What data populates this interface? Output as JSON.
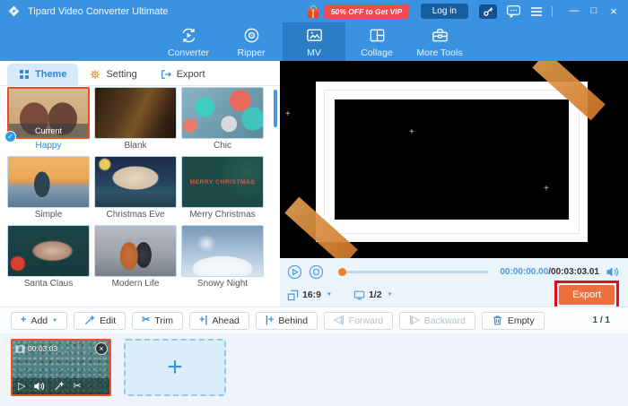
{
  "titlebar": {
    "title": "Tipard Video Converter Ultimate",
    "promo": "50% OFF to Get VIP",
    "login_label": "Log in"
  },
  "tabs": [
    {
      "id": "converter",
      "label": "Converter",
      "icon": "converter-icon",
      "active": false
    },
    {
      "id": "ripper",
      "label": "Ripper",
      "icon": "ripper-icon",
      "active": false
    },
    {
      "id": "mv",
      "label": "MV",
      "icon": "mv-icon",
      "active": true
    },
    {
      "id": "collage",
      "label": "Collage",
      "icon": "collage-icon",
      "active": false
    },
    {
      "id": "more-tools",
      "label": "More Tools",
      "icon": "more-tools-icon",
      "active": false
    }
  ],
  "panel": {
    "tabs": [
      {
        "id": "theme",
        "label": "Theme",
        "icon": "theme-grid-icon",
        "active": true
      },
      {
        "id": "setting",
        "label": "Setting",
        "icon": "gear-icon",
        "active": false
      },
      {
        "id": "export",
        "label": "Export",
        "icon": "export-icon",
        "active": false
      }
    ]
  },
  "themes": [
    {
      "name": "Happy",
      "selected": true,
      "badge": "Current",
      "bg": "radial-gradient(ellipse 30% 55% at 32% 62%, #7a4a3a 0%, #7a4a3a 60%, transparent 62%), radial-gradient(ellipse 30% 55% at 68% 62%, #6a4434 0%, #6a4434 60%, transparent 62%), linear-gradient(180deg,#d8b890,#c8a070)"
    },
    {
      "name": "Blank",
      "bg": "linear-gradient(115deg,#2a1c10 0%, #54381e 35%, #7a5428 55%, #3a2414 80%, #1e120a 100%)"
    },
    {
      "name": "Chic",
      "bg": "radial-gradient(circle 11px at 28% 38%, #3ecfc4 98%, transparent), radial-gradient(circle 12px at 72% 25%, #e86a5c 98%, transparent), radial-gradient(circle 9px at 58% 72%, #d8dade 98%, transparent), radial-gradient(circle 13px at 88% 62%, #42c4bc 98%, transparent), radial-gradient(circle 8px at 10% 75%, #e87a6c 98%, transparent), linear-gradient(135deg,#8ab4c4,#5a8a9c)"
    },
    {
      "name": "Simple",
      "bg": "radial-gradient(ellipse 16% 42% at 42% 55%, #2e4450 0%, #2e4450 60%, transparent 62%), linear-gradient(180deg,#f0b468 0%, #ecaa58 40%, #d89858 52%, #88a0b0 58%, #5a7a96 100%)"
    },
    {
      "name": "Christmas Eve",
      "bg": "radial-gradient(ellipse 55% 45% at 50% 42%, #e8d8c0 0%, #d0c0a8 50%, transparent 53%), radial-gradient(circle at 12% 15%, #e8c860 6%, transparent 8%), linear-gradient(180deg,#1c2c4a 0%, #24405c 45%, #2e5468 70%, #243c4a 100%)"
    },
    {
      "name": "Merry Christmas",
      "text": "MERRY CHRISTMAS",
      "bg": "radial-gradient(circle at 80% 30%, #2a5a55 0%, transparent 40%), #1d4a47"
    },
    {
      "name": "Santa Claus",
      "bg": "radial-gradient(ellipse 50% 40% at 55% 50%, #d8b8a0 0%, #b08878 45%, transparent 52%), radial-gradient(circle at 12% 75%, #d8402e 8%, transparent 10%), linear-gradient(180deg,#1e4546,#173a3c)"
    },
    {
      "name": "Modern Life",
      "bg": "radial-gradient(ellipse 18% 45% at 42% 60%, #c8703a 0%, #b86030 60%, transparent 63%), radial-gradient(ellipse 16% 42% at 60% 58%, #3a3a42 0%, #2a2a32 60%, transparent 63%), linear-gradient(180deg,#b8bcc4 0%, #9aa0a8 60%, #787e88 100%)"
    },
    {
      "name": "Snowy Night",
      "bg": "radial-gradient(ellipse 60% 40% at 50% 85%, #f8fafc 0%, #eef2f8 60%, transparent 63%), radial-gradient(ellipse 20% 30% at 30% 35%, #e8eef4 0%, transparent 60%), linear-gradient(180deg,#7a98b8 0%, #a8c0d8 50%, #d8e4f0 100%)"
    }
  ],
  "preview": {
    "time_current": "00:00:00.00",
    "time_total": "/00:03:03.01",
    "aspect_ratio": "16:9",
    "screen_page": "1/2",
    "export_label": "Export"
  },
  "toolbar": {
    "buttons": [
      {
        "name": "add-button",
        "label": "Add",
        "glyph": "+",
        "caret": true,
        "disabled": false
      },
      {
        "name": "edit-button",
        "label": "Edit",
        "icon": "wand-icon",
        "disabled": false
      },
      {
        "name": "trim-button",
        "label": "Trim",
        "glyph": "✂",
        "disabled": false
      },
      {
        "name": "ahead-button",
        "label": "Ahead",
        "glyph": "+|",
        "disabled": false
      },
      {
        "name": "behind-button",
        "label": "Behind",
        "glyph": "|+",
        "disabled": false
      },
      {
        "name": "forward-button",
        "label": "Forward",
        "glyph": "◁|",
        "disabled": true
      },
      {
        "name": "backward-button",
        "label": "Backward",
        "glyph": "|▷",
        "disabled": true
      },
      {
        "name": "empty-button",
        "label": "Empty",
        "icon": "trash-icon",
        "disabled": false
      }
    ],
    "page": "1 / 1"
  },
  "timeline": {
    "clip_duration": "00:03:03"
  },
  "icons": {
    "minimize": "—",
    "maximize": "□",
    "close": "×",
    "caret_down": "▼",
    "check": "✓",
    "play_glyph": "▷",
    "scissors": "✂",
    "plus": "+"
  },
  "colors": {
    "header_blue": "#3b92e0",
    "active_tab_blue": "#2a7dc6",
    "promo_red": "#f2484f",
    "export_orange": "#ee6f3d",
    "annotation_red": "#e60b1e",
    "selected_border": "#e8502a",
    "accent_blue": "#3a8fdd"
  }
}
